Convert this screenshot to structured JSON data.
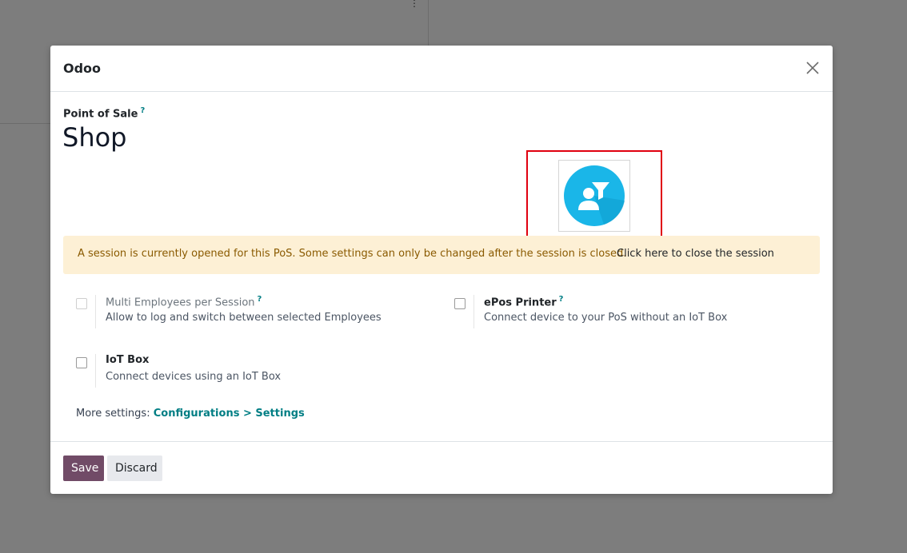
{
  "dialog": {
    "title": "Odoo",
    "field_label": "Point of Sale",
    "help_mark": "?",
    "record_name": "Shop"
  },
  "alert": {
    "message": "A session is currently opened for this PoS. Some settings can only be changed after the session is closed.",
    "link": "Click here to close the session"
  },
  "settings": [
    {
      "title": "Multi Employees per Session",
      "help": "?",
      "description": "Allow to log and switch between selected Employees",
      "checked": false,
      "disabled": true
    },
    {
      "title": "ePos Printer",
      "help": "?",
      "description": "Connect device to your PoS without an IoT Box",
      "checked": false,
      "disabled": false
    },
    {
      "title": "IoT Box",
      "description": "Connect devices using an IoT Box",
      "checked": false,
      "disabled": false
    }
  ],
  "more_settings": {
    "label": "More settings:",
    "link": "Configurations > Settings"
  },
  "footer": {
    "save": "Save",
    "discard": "Discard"
  },
  "image": {
    "icon": "user-funnel-icon",
    "circle_color": "#1ab6e8"
  },
  "colors": {
    "primary": "#714b67",
    "link": "#017e84",
    "alert_bg": "#fdf0d5",
    "alert_text": "#8a5a00",
    "highlight": "#e0000f"
  }
}
